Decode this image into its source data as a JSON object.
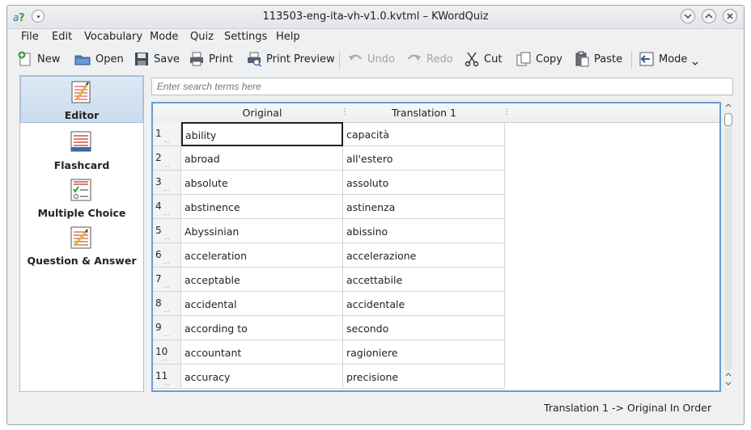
{
  "window": {
    "title": "113503-eng-ita-vh-v1.0.kvtml – KWordQuiz"
  },
  "menubar": {
    "items": [
      "File",
      "Edit",
      "Vocabulary",
      "Mode",
      "Quiz",
      "Settings",
      "Help"
    ]
  },
  "toolbar": {
    "new": "New",
    "open": "Open",
    "save": "Save",
    "print": "Print",
    "print_preview": "Print Preview",
    "undo": "Undo",
    "redo": "Redo",
    "cut": "Cut",
    "copy": "Copy",
    "paste": "Paste",
    "mode": "Mode"
  },
  "sidebar": {
    "items": [
      {
        "label": "Editor",
        "icon": "editor-icon",
        "active": true
      },
      {
        "label": "Flashcard",
        "icon": "flashcard-icon",
        "active": false
      },
      {
        "label": "Multiple Choice",
        "icon": "multiple-choice-icon",
        "active": false
      },
      {
        "label": "Question & Answer",
        "icon": "question-answer-icon",
        "active": false
      }
    ]
  },
  "search": {
    "placeholder": "Enter search terms here"
  },
  "table": {
    "columns": [
      "Original",
      "Translation 1"
    ],
    "rows": [
      {
        "num": "1",
        "original": "ability",
        "translation": "capacità"
      },
      {
        "num": "2",
        "original": "abroad",
        "translation": "all'estero"
      },
      {
        "num": "3",
        "original": "absolute",
        "translation": "assoluto"
      },
      {
        "num": "4",
        "original": "abstinence",
        "translation": "astinenza"
      },
      {
        "num": "5",
        "original": "Abyssinian",
        "translation": "abissino"
      },
      {
        "num": "6",
        "original": "acceleration",
        "translation": "accelerazione"
      },
      {
        "num": "7",
        "original": "acceptable",
        "translation": "accettabile"
      },
      {
        "num": "8",
        "original": "accidental",
        "translation": "accidentale"
      },
      {
        "num": "9",
        "original": "according to",
        "translation": "secondo"
      },
      {
        "num": "10",
        "original": "accountant",
        "translation": "ragioniere"
      },
      {
        "num": "11",
        "original": "accuracy",
        "translation": "precisione"
      }
    ]
  },
  "statusbar": {
    "text": "Translation 1 -> Original In Order"
  },
  "colors": {
    "accent": "#6a9dd0",
    "window_bg": "#eff0f1"
  }
}
